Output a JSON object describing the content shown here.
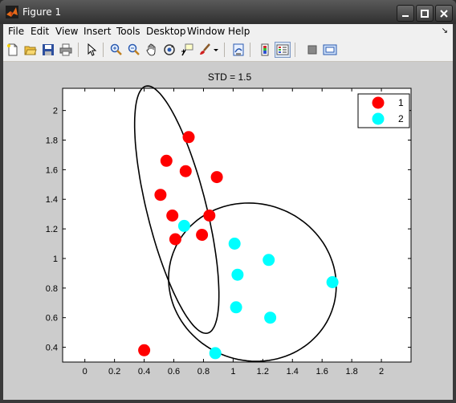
{
  "window": {
    "title": "Figure 1"
  },
  "menu": {
    "file": "File",
    "edit": "Edit",
    "view": "View",
    "insert": "Insert",
    "tools": "Tools",
    "desktop": "Desktop",
    "window": "Window",
    "help": "Help"
  },
  "toolbar": {
    "icons": [
      "new-figure-icon",
      "open-file-icon",
      "save-icon",
      "print-icon",
      "edit-plot-arrow-icon",
      "zoom-in-icon",
      "zoom-out-icon",
      "pan-hand-icon",
      "rotate-3d-icon",
      "data-cursor-icon",
      "brush-icon",
      "brush-dropdown-icon",
      "link-plot-icon",
      "colorbar-icon",
      "legend-icon",
      "hide-plot-tools-icon",
      "show-plot-tools-icon"
    ]
  },
  "chart_data": {
    "type": "scatter",
    "title": "STD = 1.5",
    "xlim": [
      -0.15,
      2.2
    ],
    "ylim": [
      0.3,
      2.15
    ],
    "xticks": [
      "0",
      "0.2",
      "0.4",
      "0.6",
      "0.8",
      "1",
      "1.2",
      "1.4",
      "1.6",
      "1.8",
      "2"
    ],
    "yticks": [
      "0.4",
      "0.6",
      "0.8",
      "1",
      "1.2",
      "1.4",
      "1.6",
      "1.8",
      "2"
    ],
    "grid": false,
    "legend_position": "top-right",
    "series": [
      {
        "name": "1",
        "color": "#ff0000",
        "points": [
          [
            0.4,
            0.38
          ],
          [
            0.51,
            1.43
          ],
          [
            0.55,
            1.66
          ],
          [
            0.59,
            1.29
          ],
          [
            0.61,
            1.13
          ],
          [
            0.68,
            1.59
          ],
          [
            0.7,
            1.82
          ],
          [
            0.79,
            1.16
          ],
          [
            0.84,
            1.29
          ],
          [
            0.89,
            1.55
          ]
        ]
      },
      {
        "name": "2",
        "color": "#00ffff",
        "points": [
          [
            0.67,
            1.22
          ],
          [
            0.88,
            0.36
          ],
          [
            1.01,
            1.1
          ],
          [
            1.02,
            0.67
          ],
          [
            1.03,
            0.89
          ],
          [
            1.24,
            0.99
          ],
          [
            1.25,
            0.6
          ],
          [
            1.67,
            0.84
          ]
        ]
      }
    ],
    "ellipses": [
      {
        "series": "1",
        "color": "#000000",
        "cx": 0.62,
        "cy": 1.33,
        "rx": 0.2,
        "ry": 0.86,
        "angle": 14
      },
      {
        "series": "2",
        "color": "#000000",
        "cx": 1.13,
        "cy": 0.84,
        "rx": 0.57,
        "ry": 0.53,
        "angle": -20
      }
    ]
  }
}
